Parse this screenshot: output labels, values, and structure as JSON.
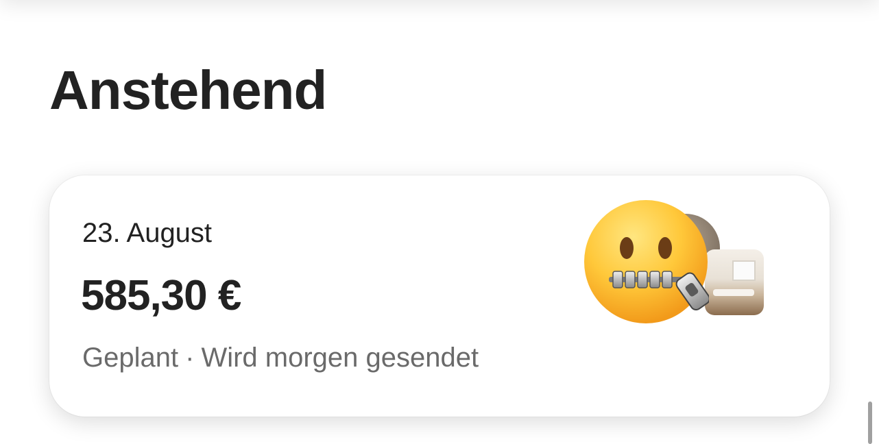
{
  "section": {
    "title": "Anstehend"
  },
  "payout": {
    "date": "23. August",
    "amount": "585,30 €",
    "status": "Geplant",
    "separator": "·",
    "status_detail": "Wird morgen gesendet"
  },
  "icons": {
    "emoji": "zipper-mouth-face-icon",
    "listing": "listing-photo-thumbnail"
  },
  "colors": {
    "text_primary": "#222222",
    "text_secondary": "#6a6a6a",
    "background": "#ffffff"
  }
}
